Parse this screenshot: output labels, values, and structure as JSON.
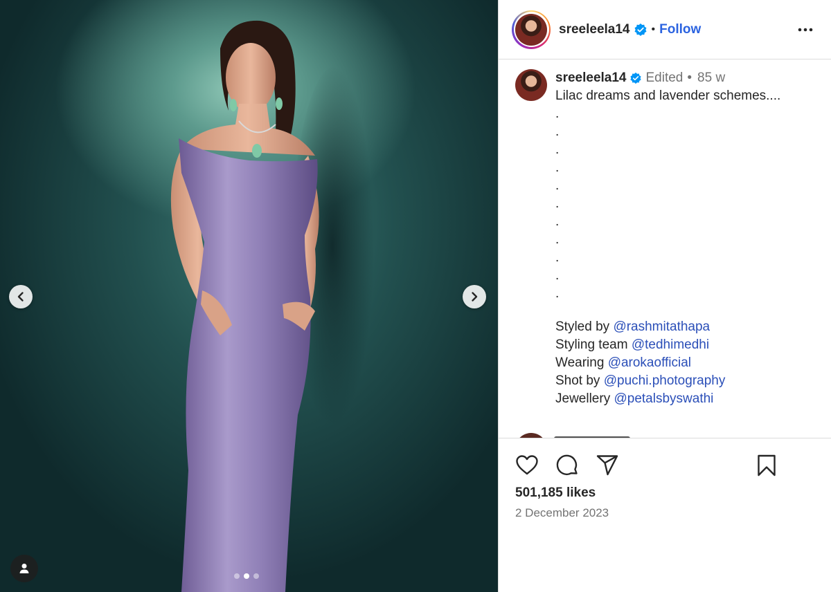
{
  "post": {
    "username": "sreeleela14",
    "follow_label": "Follow",
    "separator": "•",
    "verified_icon": "verified-badge-icon",
    "accent_color": "#2b63e0",
    "caption": {
      "username": "sreeleela14",
      "edited": "Edited",
      "separator": "•",
      "time": "85 w",
      "text": "Lilac dreams and lavender schemes....",
      "dots": [
        ".",
        ".",
        ".",
        ".",
        ".",
        ".",
        ".",
        ".",
        ".",
        ".",
        "."
      ],
      "credits": [
        {
          "label": "Styled by",
          "mention": "@rashmitathapa"
        },
        {
          "label": "Styling team",
          "mention": "@tedhimedhi"
        },
        {
          "label": "Wearing",
          "mention": "@arokaofficial"
        },
        {
          "label": "Shot by",
          "mention": "@puchi.photography"
        },
        {
          "label": "Jewellery",
          "mention": "@petalsbyswathi"
        }
      ]
    },
    "likes": "501,185 likes",
    "date": "2 December 2023",
    "carousel": {
      "total": 3,
      "active": 2
    }
  }
}
